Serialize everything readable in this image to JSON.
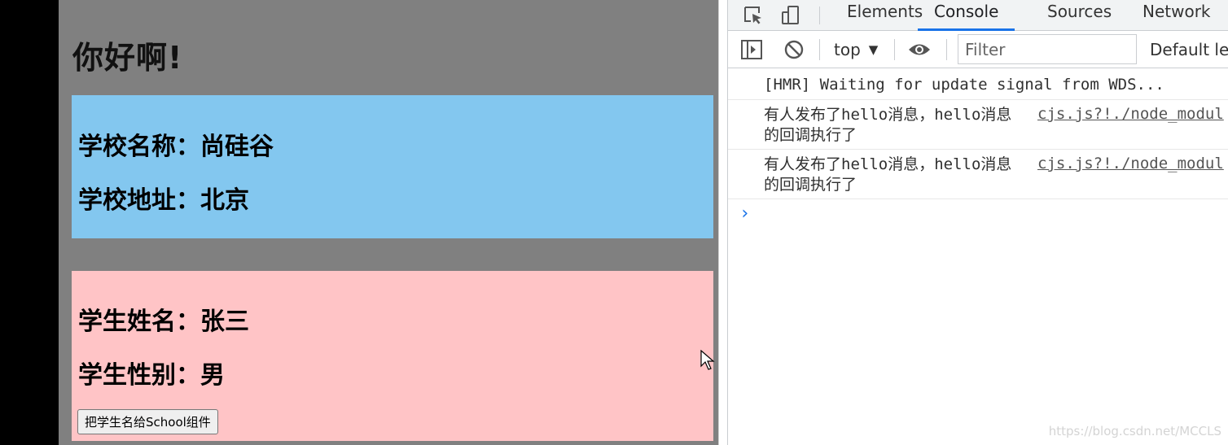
{
  "app": {
    "title": "你好啊!",
    "school": {
      "name_line": "学校名称：尚硅谷",
      "address_line": "学校地址：北京"
    },
    "student": {
      "name_line": "学生姓名：张三",
      "gender_line": "学生性别：男",
      "send_button_label": "把学生名给School组件"
    }
  },
  "devtools": {
    "tabs": [
      {
        "label": "Elements",
        "active": false
      },
      {
        "label": "Console",
        "active": true
      },
      {
        "label": "Sources",
        "active": false
      },
      {
        "label": "Network",
        "active": false
      }
    ],
    "toolbar": {
      "context": "top",
      "filter_placeholder": "Filter",
      "levels_label": "Default lev"
    },
    "messages": [
      {
        "text": "[HMR] Waiting for update signal from WDS...",
        "source": ""
      },
      {
        "text": "有人发布了hello消息，hello消息的回调执行了",
        "source": "cjs.js?!./node_modul"
      },
      {
        "text": "有人发布了hello消息，hello消息的回调执行了",
        "source": "cjs.js?!./node_modul"
      }
    ],
    "prompt_symbol": "›"
  },
  "watermark": "https://blog.csdn.net/MCCLS",
  "icons": {
    "inspect": "inspect-element-icon",
    "device": "device-toolbar-icon",
    "sidebar": "show-sidebar-icon",
    "clear": "clear-console-icon",
    "eye": "live-expression-icon"
  },
  "colors": {
    "page_bg": "#808080",
    "school_bg": "#83c7ef",
    "student_bg": "#ffc4c6",
    "accent": "#1a73e8"
  }
}
